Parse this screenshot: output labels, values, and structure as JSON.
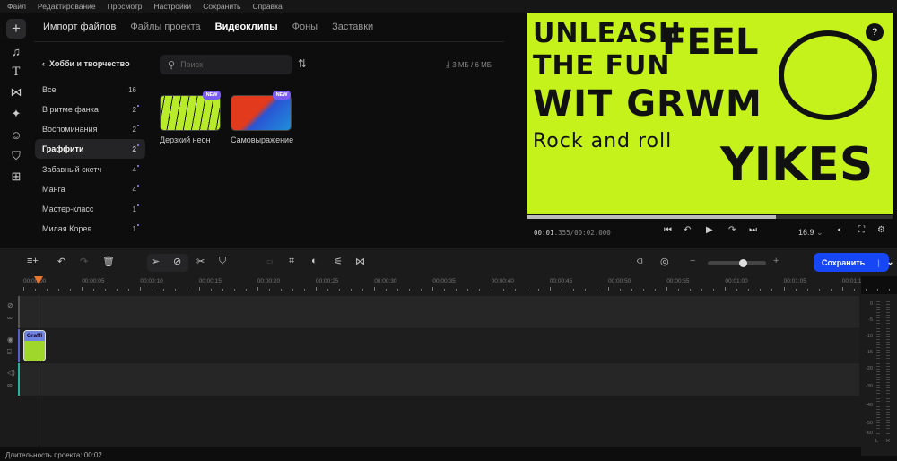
{
  "menu": [
    "Файл",
    "Редактирование",
    "Просмотр",
    "Настройки",
    "Сохранить",
    "Справка"
  ],
  "tabs": [
    "Импорт файлов",
    "Файлы проекта",
    "Видеоклипы",
    "Фоны",
    "Заставки"
  ],
  "category_title": "Хобби и творчество",
  "categories": [
    {
      "label": "Все",
      "count": "16"
    },
    {
      "label": "В ритме фанка",
      "count": "2"
    },
    {
      "label": "Воспоминания",
      "count": "2"
    },
    {
      "label": "Граффити",
      "count": "2"
    },
    {
      "label": "Забавный скетч",
      "count": "4"
    },
    {
      "label": "Манга",
      "count": "4"
    },
    {
      "label": "Мастер-класс",
      "count": "1"
    },
    {
      "label": "Милая Корея",
      "count": "1"
    }
  ],
  "search": {
    "placeholder": "Поиск"
  },
  "storage": "3 МБ / 6 МБ",
  "clips": [
    {
      "label": "Дерзкий неон",
      "badge": "NEW"
    },
    {
      "label": "Самовыражение",
      "badge": "NEW"
    }
  ],
  "preview": {
    "graffiti_text": [
      "UNLEASH",
      "THE FUN",
      "WIT GRWM",
      "Rock and roll",
      "FEEL",
      "YIKES"
    ],
    "progress": 0.68,
    "time_current": "00:01",
    "time_ms": ".355",
    "time_total": "/00:02.000",
    "aspect": "16:9"
  },
  "save": {
    "label": "Сохранить"
  },
  "ruler": [
    "00:00:00",
    "00:00:05",
    "00:00:10",
    "00:00:15",
    "00:00:20",
    "00:00:25",
    "00:00:30",
    "00:00:35",
    "00:00:40",
    "00:00:45",
    "00:00:50",
    "00:00:55",
    "00:01:00",
    "00:01:05",
    "00:01:1"
  ],
  "clip_label": "Graffi",
  "meter": {
    "levels": [
      "0",
      "-5",
      "-10",
      "-15",
      "-20",
      "-30",
      "-40",
      "-50",
      "-60"
    ],
    "channels": [
      "L",
      "R"
    ]
  },
  "status": "Длительность проекта: 00:02",
  "colors": {
    "accent": "#1747f5",
    "playhead": "#e8752a",
    "badge": "#7a5cf0"
  }
}
